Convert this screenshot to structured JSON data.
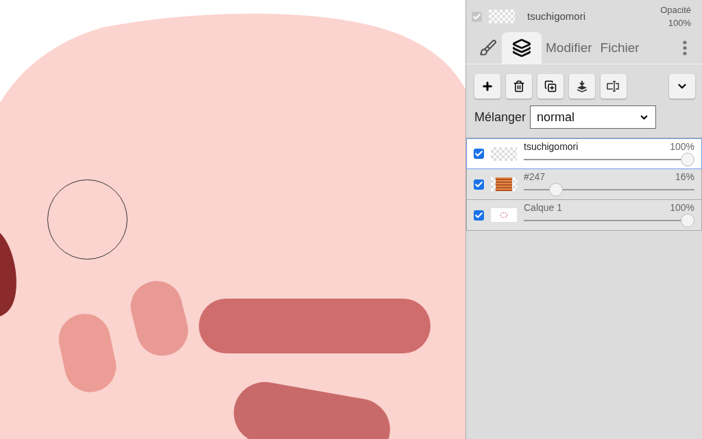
{
  "header": {
    "checked": true,
    "name": "tsuchigomori",
    "opacity_label": "Opacité",
    "opacity_value": "100%"
  },
  "tabs": [
    {
      "kind": "brush",
      "selected": false
    },
    {
      "kind": "layers",
      "selected": true
    },
    {
      "kind": "text",
      "label": "Modifier",
      "selected": false
    },
    {
      "kind": "text",
      "label": "Fichier",
      "selected": false
    }
  ],
  "toolbar": [
    {
      "kind": "add"
    },
    {
      "kind": "delete"
    },
    {
      "kind": "duplicate"
    },
    {
      "kind": "merge"
    },
    {
      "kind": "rename"
    }
  ],
  "blend": {
    "label": "Mélanger",
    "value": "normal"
  },
  "layers": [
    {
      "name": "tsuchigomori",
      "reading": "100%",
      "level": 1,
      "checked": true,
      "selected": true,
      "thumb": {
        "kind": "empty"
      }
    },
    {
      "name": "#247",
      "reading": "16%",
      "level": 0.16,
      "checked": true,
      "selected": false,
      "thumb": {
        "kind": "lines"
      }
    },
    {
      "name": "Calque 1",
      "reading": "100%",
      "level": 1,
      "checked": true,
      "selected": false,
      "thumb": {
        "kind": "sketch"
      }
    }
  ]
}
